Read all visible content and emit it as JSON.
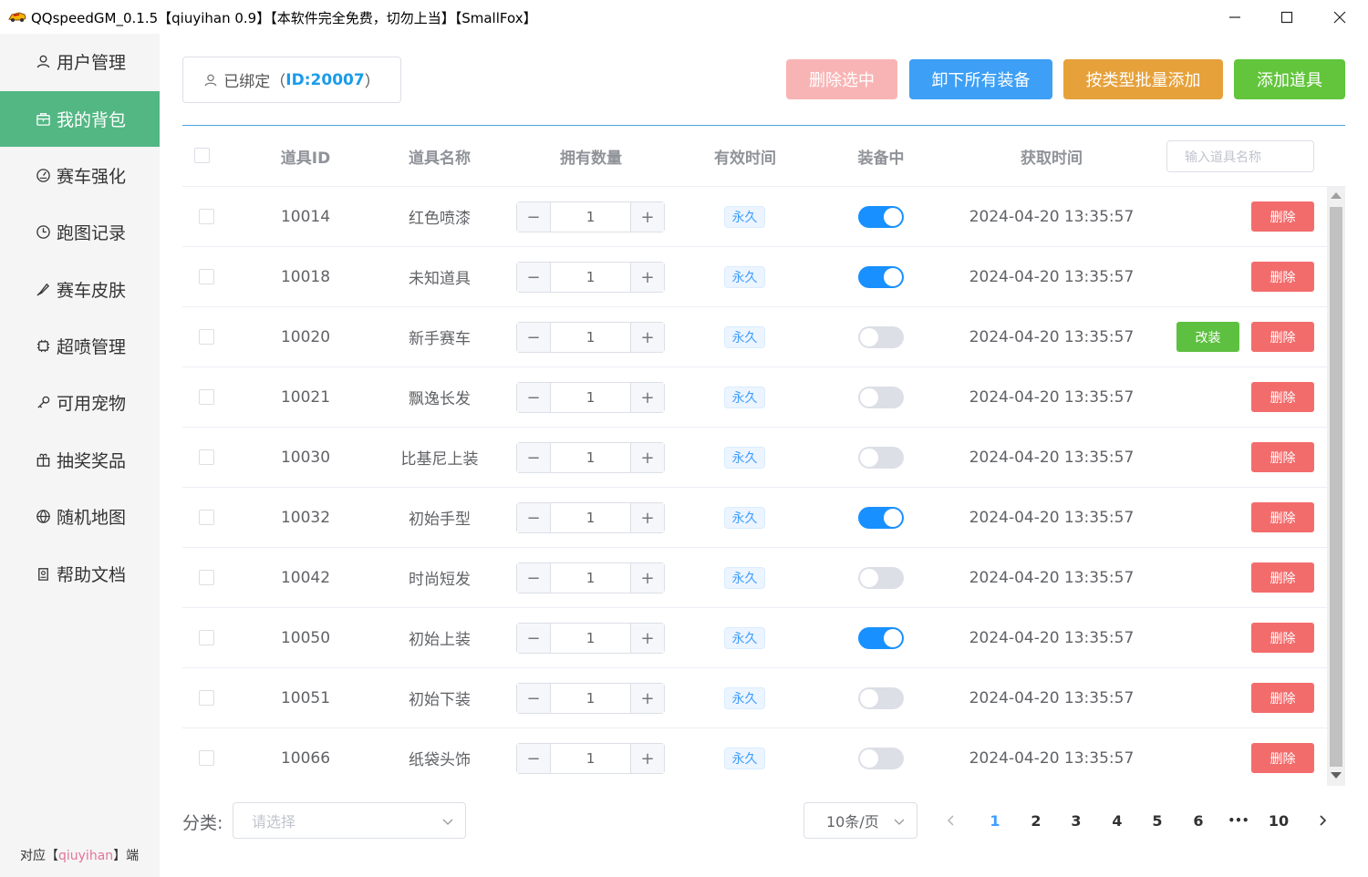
{
  "window": {
    "title": "QQspeedGM_0.1.5【qiuyihan 0.9】【本软件完全免费，切勿上当】【SmallFox】"
  },
  "sidebar": {
    "items": [
      {
        "label": "用户管理",
        "icon": "user-icon"
      },
      {
        "label": "我的背包",
        "icon": "bag-icon",
        "active": true
      },
      {
        "label": "赛车强化",
        "icon": "gauge-icon"
      },
      {
        "label": "跑图记录",
        "icon": "clock-icon"
      },
      {
        "label": "赛车皮肤",
        "icon": "brush-icon"
      },
      {
        "label": "超喷管理",
        "icon": "chip-icon"
      },
      {
        "label": "可用宠物",
        "icon": "pet-icon"
      },
      {
        "label": "抽奖奖品",
        "icon": "gift-icon"
      },
      {
        "label": "随机地图",
        "icon": "globe-icon"
      },
      {
        "label": "帮助文档",
        "icon": "doc-icon"
      }
    ],
    "footer": {
      "prefix": "对应【",
      "user": "qiuyihan",
      "suffix": "】端"
    }
  },
  "bind_status": {
    "label": "已绑定",
    "open": "（",
    "uid": "ID:20007",
    "close": "）"
  },
  "toolbar": {
    "delete_selected": "删除选中",
    "unequip_all": "卸下所有装备",
    "batch_add_by_type": "按类型批量添加",
    "add_item": "添加道具"
  },
  "table": {
    "headers": {
      "item_id": "道具ID",
      "item_name": "道具名称",
      "quantity": "拥有数量",
      "validity": "有效时间",
      "equipped": "装备中",
      "acquired": "获取时间"
    },
    "search_placeholder": "输入道具名称",
    "delete_label": "删除",
    "modify_label": "改装",
    "rows": [
      {
        "id": "10014",
        "name": "红色喷漆",
        "qty": "1",
        "validity": "永久",
        "equipped": true,
        "time": "2024-04-20 13:35:57",
        "modify": false
      },
      {
        "id": "10018",
        "name": "未知道具",
        "qty": "1",
        "validity": "永久",
        "equipped": true,
        "time": "2024-04-20 13:35:57",
        "modify": false
      },
      {
        "id": "10020",
        "name": "新手赛车",
        "qty": "1",
        "validity": "永久",
        "equipped": false,
        "time": "2024-04-20 13:35:57",
        "modify": true
      },
      {
        "id": "10021",
        "name": "飘逸长发",
        "qty": "1",
        "validity": "永久",
        "equipped": false,
        "time": "2024-04-20 13:35:57",
        "modify": false
      },
      {
        "id": "10030",
        "name": "比基尼上装",
        "qty": "1",
        "validity": "永久",
        "equipped": false,
        "time": "2024-04-20 13:35:57",
        "modify": false
      },
      {
        "id": "10032",
        "name": "初始手型",
        "qty": "1",
        "validity": "永久",
        "equipped": true,
        "time": "2024-04-20 13:35:57",
        "modify": false
      },
      {
        "id": "10042",
        "name": "时尚短发",
        "qty": "1",
        "validity": "永久",
        "equipped": false,
        "time": "2024-04-20 13:35:57",
        "modify": false
      },
      {
        "id": "10050",
        "name": "初始上装",
        "qty": "1",
        "validity": "永久",
        "equipped": true,
        "time": "2024-04-20 13:35:57",
        "modify": false
      },
      {
        "id": "10051",
        "name": "初始下装",
        "qty": "1",
        "validity": "永久",
        "equipped": false,
        "time": "2024-04-20 13:35:57",
        "modify": false
      },
      {
        "id": "10066",
        "name": "纸袋头饰",
        "qty": "1",
        "validity": "永久",
        "equipped": false,
        "time": "2024-04-20 13:35:57",
        "modify": false
      }
    ]
  },
  "footer": {
    "category_label": "分类:",
    "category_placeholder": "请选择",
    "page_size": "10条/页",
    "pages": [
      "1",
      "2",
      "3",
      "4",
      "5",
      "6",
      "•••",
      "10"
    ],
    "current_page": "1"
  },
  "colors": {
    "sidebar_active": "#52b783",
    "primary": "#409eff",
    "danger": "#f36c6c",
    "success": "#5dc040",
    "warning": "#e6a13b"
  }
}
